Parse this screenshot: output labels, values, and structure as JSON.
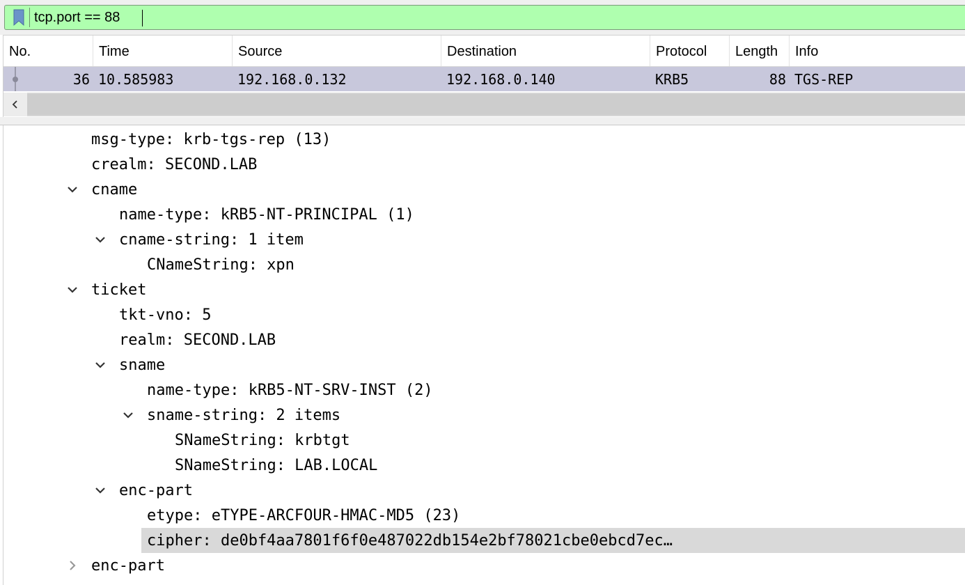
{
  "filter": {
    "value": "tcp.port == 88",
    "bar_color": "#afffaf"
  },
  "packet_list": {
    "columns": [
      "No.",
      "Time",
      "Source",
      "Destination",
      "Protocol",
      "Length",
      "Info"
    ],
    "rows": [
      {
        "no": "36",
        "time": "10.585983",
        "source": "192.168.0.132",
        "destination": "192.168.0.140",
        "protocol": "KRB5",
        "length": "88",
        "info": "TGS-REP",
        "selected": true
      }
    ],
    "scroll_left_icon": "chevron-left-icon"
  },
  "details": {
    "rows": [
      {
        "text": "msg-type: krb-tgs-rep (13)",
        "expander": "none"
      },
      {
        "text": "crealm: SECOND.LAB",
        "expander": "none"
      },
      {
        "text": "cname",
        "expander": "expanded"
      },
      {
        "text": "name-type: kRB5-NT-PRINCIPAL (1)",
        "expander": "none"
      },
      {
        "text": "cname-string: 1 item",
        "expander": "expanded"
      },
      {
        "text": "CNameString: xpn",
        "expander": "none"
      },
      {
        "text": "ticket",
        "expander": "expanded"
      },
      {
        "text": "tkt-vno: 5",
        "expander": "none"
      },
      {
        "text": "realm: SECOND.LAB",
        "expander": "none"
      },
      {
        "text": "sname",
        "expander": "expanded"
      },
      {
        "text": "name-type: kRB5-NT-SRV-INST (2)",
        "expander": "none"
      },
      {
        "text": "sname-string: 2 items",
        "expander": "expanded"
      },
      {
        "text": "SNameString: krbtgt",
        "expander": "none"
      },
      {
        "text": "SNameString: LAB.LOCAL",
        "expander": "none"
      },
      {
        "text": "enc-part",
        "expander": "expanded"
      },
      {
        "text": "etype: eTYPE-ARCFOUR-HMAC-MD5 (23)",
        "expander": "none"
      },
      {
        "text": "cipher: de0bf4aa7801f6f0e487022db154e2bf78021cbe0ebcd7ec…",
        "expander": "none",
        "selected": true
      },
      {
        "text": "enc-part",
        "expander": "collapsed"
      }
    ]
  },
  "colors": {
    "selected_packet_row": "#c8c8dc",
    "selected_detail_row": "#d9d9d9"
  }
}
